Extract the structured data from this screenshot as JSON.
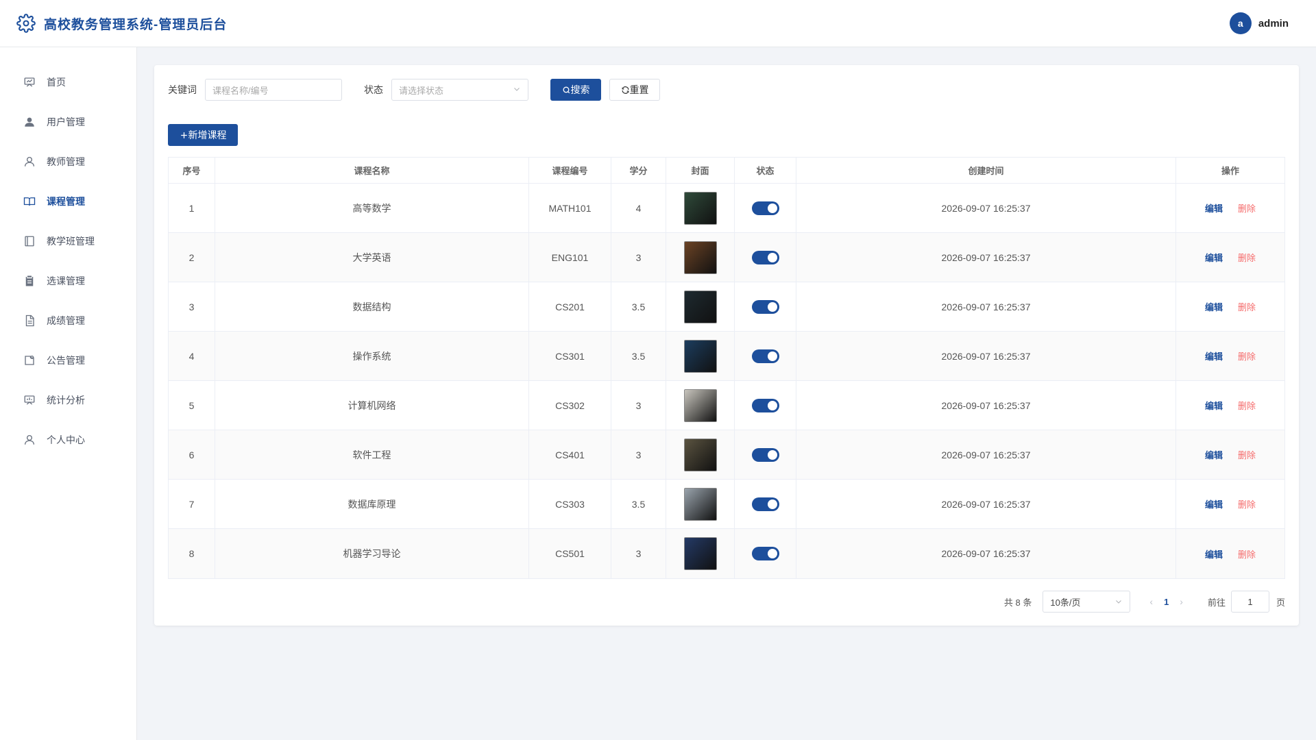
{
  "header": {
    "title": "高校教务管理系统-管理员后台",
    "logo_icon": "gear-icon",
    "user": {
      "avatar_letter": "a",
      "name": "admin"
    }
  },
  "sidebar": {
    "items": [
      {
        "label": "首页",
        "icon": "dashboard-icon",
        "active": false
      },
      {
        "label": "用户管理",
        "icon": "user-icon",
        "active": false
      },
      {
        "label": "教师管理",
        "icon": "teacher-icon",
        "active": false
      },
      {
        "label": "课程管理",
        "icon": "book-icon",
        "active": true
      },
      {
        "label": "教学班管理",
        "icon": "notebook-icon",
        "active": false
      },
      {
        "label": "选课管理",
        "icon": "clipboard-icon",
        "active": false
      },
      {
        "label": "成绩管理",
        "icon": "document-icon",
        "active": false
      },
      {
        "label": "公告管理",
        "icon": "announcement-icon",
        "active": false
      },
      {
        "label": "统计分析",
        "icon": "chart-icon",
        "active": false
      },
      {
        "label": "个人中心",
        "icon": "profile-icon",
        "active": false
      }
    ]
  },
  "filters": {
    "keyword_label": "关键词",
    "keyword_placeholder": "课程名称/编号",
    "status_label": "状态",
    "status_placeholder": "请选择状态",
    "search_label": "搜索",
    "reset_label": "重置"
  },
  "add_button_label": "新增课程",
  "table": {
    "columns": [
      "序号",
      "课程名称",
      "课程编号",
      "学分",
      "封面",
      "状态",
      "创建时间",
      "操作"
    ],
    "edit_label": "编辑",
    "delete_label": "删除",
    "rows": [
      {
        "index": "1",
        "name": "高等数学",
        "code": "MATH101",
        "credits": "4",
        "cover_color": "#2f4a3a",
        "status_on": true,
        "created": "2026-09-07 16:25:37"
      },
      {
        "index": "2",
        "name": "大学英语",
        "code": "ENG101",
        "credits": "3",
        "cover_color": "#6b4325",
        "status_on": true,
        "created": "2026-09-07 16:25:37"
      },
      {
        "index": "3",
        "name": "数据结构",
        "code": "CS201",
        "credits": "3.5",
        "cover_color": "#1e2a30",
        "status_on": true,
        "created": "2026-09-07 16:25:37"
      },
      {
        "index": "4",
        "name": "操作系统",
        "code": "CS301",
        "credits": "3.5",
        "cover_color": "#1c3d5e",
        "status_on": true,
        "created": "2026-09-07 16:25:37"
      },
      {
        "index": "5",
        "name": "计算机网络",
        "code": "CS302",
        "credits": "3",
        "cover_color": "#c9c6be",
        "status_on": true,
        "created": "2026-09-07 16:25:37"
      },
      {
        "index": "6",
        "name": "软件工程",
        "code": "CS401",
        "credits": "3",
        "cover_color": "#5a5340",
        "status_on": true,
        "created": "2026-09-07 16:25:37"
      },
      {
        "index": "7",
        "name": "数据库原理",
        "code": "CS303",
        "credits": "3.5",
        "cover_color": "#9aa4ad",
        "status_on": true,
        "created": "2026-09-07 16:25:37"
      },
      {
        "index": "8",
        "name": "机器学习导论",
        "code": "CS501",
        "credits": "3",
        "cover_color": "#243a66",
        "status_on": true,
        "created": "2026-09-07 16:25:37"
      }
    ]
  },
  "pagination": {
    "total_text": "共 8 条",
    "page_size": "10条/页",
    "current_page": "1",
    "goto_label": "前往",
    "goto_value": "1",
    "page_suffix": "页"
  },
  "colors": {
    "primary": "#1d4f9c",
    "danger": "#f56c6c"
  }
}
